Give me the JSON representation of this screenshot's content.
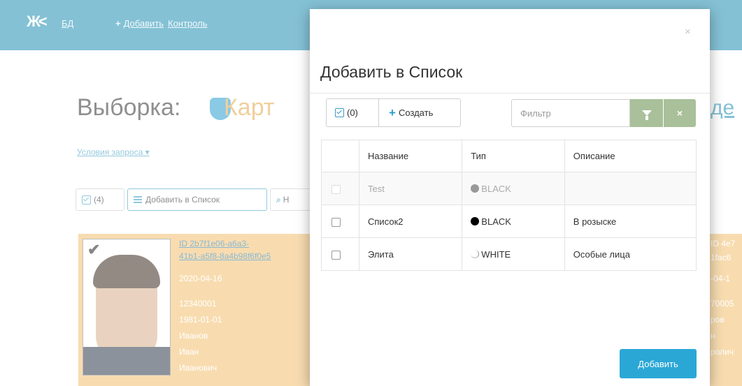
{
  "topbar": {
    "logo": "Ж<",
    "nav_db": "БД",
    "nav_add_plus": "+",
    "nav_add": "Добавить",
    "nav_control": "Контроль"
  },
  "page": {
    "title": "Выборка:",
    "title_suffix": "Карт",
    "right_link": "де",
    "conditions": "Условия запроса ▾",
    "btn_check_count": "(4)",
    "btn_add_list": "Добавить в Список",
    "btn_search": "Н"
  },
  "card": {
    "link1": "ID 2b7f1e06-a6a3-",
    "link2": "41b1-a5f8-8a4b98f6f0e5",
    "date": "2020-04-16",
    "lines": [
      "12340001",
      "1981-01-01",
      "Иванов",
      "Иван",
      "Иванович"
    ],
    "right_lines": [
      "ID 4e7",
      "1fac6",
      "-04-1",
      "70005",
      "ров",
      "н",
      "ролич"
    ]
  },
  "modal": {
    "title": "Добавить в Список",
    "close": "×",
    "check_count": "(0)",
    "create_label": "Создать",
    "filter_placeholder": "Фильтр",
    "clear_label": "×",
    "columns": [
      "Название",
      "Тип",
      "Описание"
    ],
    "rows": [
      {
        "name": "Test",
        "type": "BLACK",
        "description": "",
        "disabled": true
      },
      {
        "name": "Список2",
        "type": "BLACK",
        "description": "В розыске",
        "disabled": false
      },
      {
        "name": "Элита",
        "type": "WHITE",
        "description": "Особые лица",
        "disabled": false
      }
    ],
    "submit": "Добавить"
  },
  "colors": {
    "topbar": "#1f8fb3",
    "accent": "#2ba7d6",
    "card": "#f3c070",
    "filter_button": "#a9c09a"
  },
  "icons": [
    "logo-icon",
    "plus-icon",
    "checkbox-icon",
    "list-icon",
    "search-icon",
    "filter-icon",
    "close-icon",
    "shield-icon"
  ]
}
